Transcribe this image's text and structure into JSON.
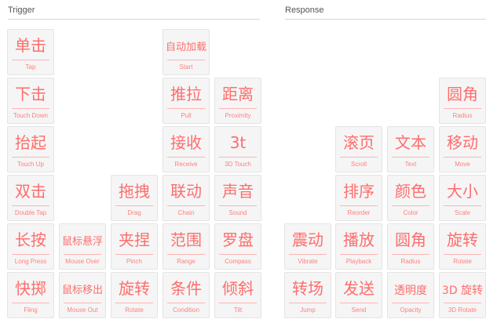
{
  "sections": {
    "trigger": "Trigger",
    "response": "Response"
  },
  "trigger_tiles": [
    {
      "main": "单击",
      "sub": "Tap"
    },
    {
      "main": "自动加载",
      "sub": "Start"
    },
    {
      "main": "下击",
      "sub": "Touch Down"
    },
    {
      "main": "推拉",
      "sub": "Pull"
    },
    {
      "main": "距离",
      "sub": "Proximity"
    },
    {
      "main": "抬起",
      "sub": "Touch Up"
    },
    {
      "main": "接收",
      "sub": "Receive"
    },
    {
      "main": "3t",
      "sub": "3D Touch"
    },
    {
      "main": "双击",
      "sub": "Double Tap"
    },
    {
      "main": "拖拽",
      "sub": "Drag"
    },
    {
      "main": "联动",
      "sub": "Chain"
    },
    {
      "main": "声音",
      "sub": "Sound"
    },
    {
      "main": "长按",
      "sub": "Long Press"
    },
    {
      "main": "鼠标悬浮",
      "sub": "Mouse Over"
    },
    {
      "main": "夹捏",
      "sub": "Pinch"
    },
    {
      "main": "范围",
      "sub": "Range"
    },
    {
      "main": "罗盘",
      "sub": "Compass"
    },
    {
      "main": "快掷",
      "sub": "Fling"
    },
    {
      "main": "鼠标移出",
      "sub": "Mouse Out"
    },
    {
      "main": "旋转",
      "sub": "Rotate"
    },
    {
      "main": "条件",
      "sub": "Condition"
    },
    {
      "main": "倾斜",
      "sub": "Tilt"
    }
  ],
  "response_tiles": [
    {
      "main": "圆角",
      "sub": "Radius"
    },
    {
      "main": "滚页",
      "sub": "Scroll"
    },
    {
      "main": "文本",
      "sub": "Text"
    },
    {
      "main": "移动",
      "sub": "Move"
    },
    {
      "main": "排序",
      "sub": "Reorder"
    },
    {
      "main": "颜色",
      "sub": "Color"
    },
    {
      "main": "大小",
      "sub": "Scale"
    },
    {
      "main": "震动",
      "sub": "Vibrate"
    },
    {
      "main": "播放",
      "sub": "Playback"
    },
    {
      "main": "圆角",
      "sub": "Radius"
    },
    {
      "main": "旋转",
      "sub": "Rotate"
    },
    {
      "main": "转场",
      "sub": "Jump"
    },
    {
      "main": "发送",
      "sub": "Send"
    },
    {
      "main": "透明度",
      "sub": "Opacity"
    },
    {
      "main": "3D 旋转",
      "sub": "3D Rotate"
    }
  ]
}
